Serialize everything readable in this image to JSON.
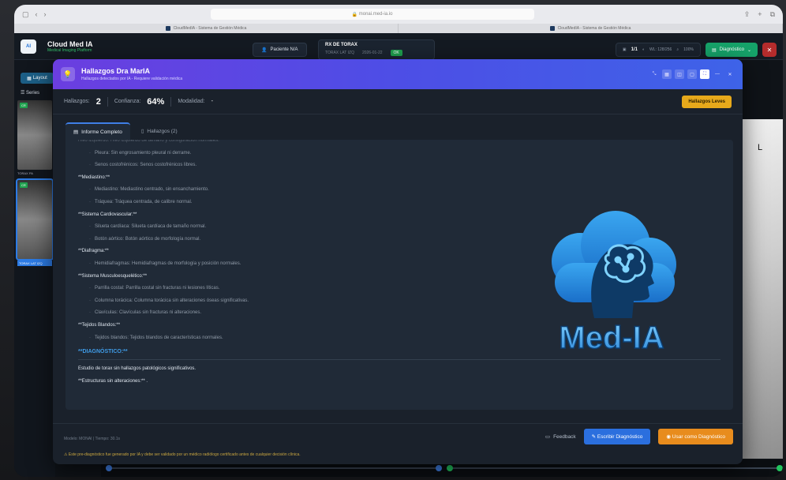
{
  "browser": {
    "url": "monai.med-ia.io",
    "tab1": "CloudMedIA - Sistema de Gestión Médica",
    "tab2": "CloudMedIA - Sistema de Gestión Médica"
  },
  "app": {
    "name": "Cloud Med IA",
    "tagline": "Medical Imaging Platform",
    "logo": "AI",
    "patient_button": "Paciente N/A",
    "study": {
      "title": "RX DE TORAX",
      "subtitle": "TORAX LAT IZQ",
      "date": "2026-01-22",
      "status": "OK"
    },
    "page_counter": "1/1",
    "wl": "WL: 128/256",
    "zoom": "100%",
    "diag_button": "Diagnóstico",
    "layout_button": "Layout",
    "series_label": "Series",
    "thumbs": [
      {
        "tag": "CR",
        "label": "TORAX PA"
      },
      {
        "tag": "CR",
        "label": "TORAX LAT IZQ"
      }
    ],
    "viewer_marker": "L"
  },
  "modal": {
    "title": "Hallazgos Dra MarIA",
    "subtitle": "Hallazgos detectados por IA - Requiere validación médica",
    "stats": {
      "hallazgos_label": "Hallazgos:",
      "hallazgos_value": "2",
      "confianza_label": "Confianza:",
      "confianza_value": "64%",
      "modalidad_label": "Modalidad:",
      "modalidad_value": "-"
    },
    "leves_button": "Hallazgos Leves",
    "tabs": [
      "Informe Completo",
      "Hallazgos (2)"
    ],
    "report_lines": [
      {
        "k": "cut",
        "text": "Hilio izquierdo: Hilio izquierdo de tamaño y configuración normales."
      },
      {
        "k": "i",
        "text": "Pleura: Sin engrosamiento pleural ni derrame."
      },
      {
        "k": "i",
        "text": "Senos costofrénicos: Senos costofrénicos libres."
      },
      {
        "k": "h",
        "text": "**Mediastino:**"
      },
      {
        "k": "i",
        "text": "Mediastino: Mediastino centrado, sin ensanchamiento."
      },
      {
        "k": "i",
        "text": "Tráquea: Tráquea centrada, de calibre normal."
      },
      {
        "k": "h",
        "text": "**Sistema Cardiovascular:**"
      },
      {
        "k": "i",
        "text": "Silueta cardíaca: Silueta cardíaca de tamaño normal."
      },
      {
        "k": "i",
        "text": "Botón aórtico: Botón aórtico de morfología normal."
      },
      {
        "k": "h",
        "text": "**Diafragma:**"
      },
      {
        "k": "i",
        "text": "Hemidiafragmas: Hemidiafragmas de morfología y posición normales."
      },
      {
        "k": "h",
        "text": "**Sistema Musculoesquelético:**"
      },
      {
        "k": "i",
        "text": "Parrilla costal: Parrilla costal sin fracturas ni lesiones líticas."
      },
      {
        "k": "i",
        "text": "Columna torácica: Columna torácica sin alteraciones óseas significativas."
      },
      {
        "k": "i",
        "text": "Clavículas: Clavículas sin fracturas ni alteraciones."
      },
      {
        "k": "h",
        "text": "**Tejidos Blandos:**"
      },
      {
        "k": "i",
        "text": "Tejidos blandos: Tejidos blandos de características normales."
      }
    ],
    "diagnostico_title": "**DIAGNÓSTICO:**",
    "diagnostico_lines": [
      "Estudio de torax sin hallazgos patológicos significativos.",
      "**Estructuras sin alteraciones:** ."
    ],
    "logo_text": "Med-IA",
    "model_info": "Modelo: MONAI  |  Tiempo: 30.1s",
    "feedback": "Feedback",
    "escribir_button": "Escribir Diagnóstico",
    "usar_button": "Usar como Diagnóstico",
    "disclaimer": "Este pre-diagnóstico fue generado por IA y debe ser validado por un médico radiólogo certificado antes de cualquier decisión clínica."
  },
  "colors": {
    "accent": "#4d4ee6",
    "orange": "#e88c1d",
    "blue": "#2b6fde",
    "green": "#16a36a",
    "warning": "#e7a91b"
  }
}
